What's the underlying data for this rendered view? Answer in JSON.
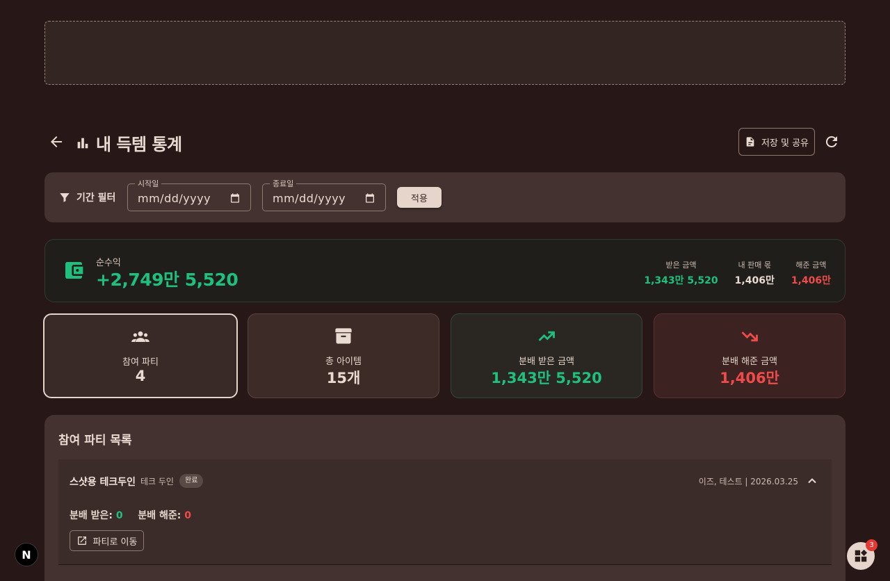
{
  "header": {
    "title": "내 득템 통계",
    "save_label": "저장 및 공유"
  },
  "filter": {
    "label": "기간 필터",
    "start_legend": "시작일",
    "start_value": "mm/dd/yyyy",
    "end_legend": "종료일",
    "end_value": "mm/dd/yyyy",
    "apply_label": "적용"
  },
  "net": {
    "label": "순수익",
    "value": "+2,749만 5,520",
    "received_label": "받은 금액",
    "received_value": "1,343만 5,520",
    "sales_label": "내 판매 몫",
    "sales_value": "1,406만",
    "given_label": "해준 금액",
    "given_value": "1,406만"
  },
  "stats": [
    {
      "label": "참여 파티",
      "value": "4"
    },
    {
      "label": "총 아이템",
      "value": "15개"
    },
    {
      "label": "분배 받은 금액",
      "value": "1,343만 5,520"
    },
    {
      "label": "분배 해준 금액",
      "value": "1,406만"
    }
  ],
  "party_list": {
    "title": "참여 파티 목록",
    "items": [
      {
        "name": "스샷용 테크두인",
        "sub": "테크 두인",
        "badge": "완료",
        "meta": "이즈, 테스트 | 2026.03.25",
        "received_label": "분배 받은:",
        "received_value": "0",
        "given_label": "분배 해준:",
        "given_value": "0",
        "go_label": "파티로 이동"
      }
    ]
  },
  "misc": {
    "n_badge": "N",
    "fab_count": "3"
  },
  "colors": {
    "positive": "#1fc07e",
    "negative": "#ef4b4b",
    "background": "#271716"
  }
}
